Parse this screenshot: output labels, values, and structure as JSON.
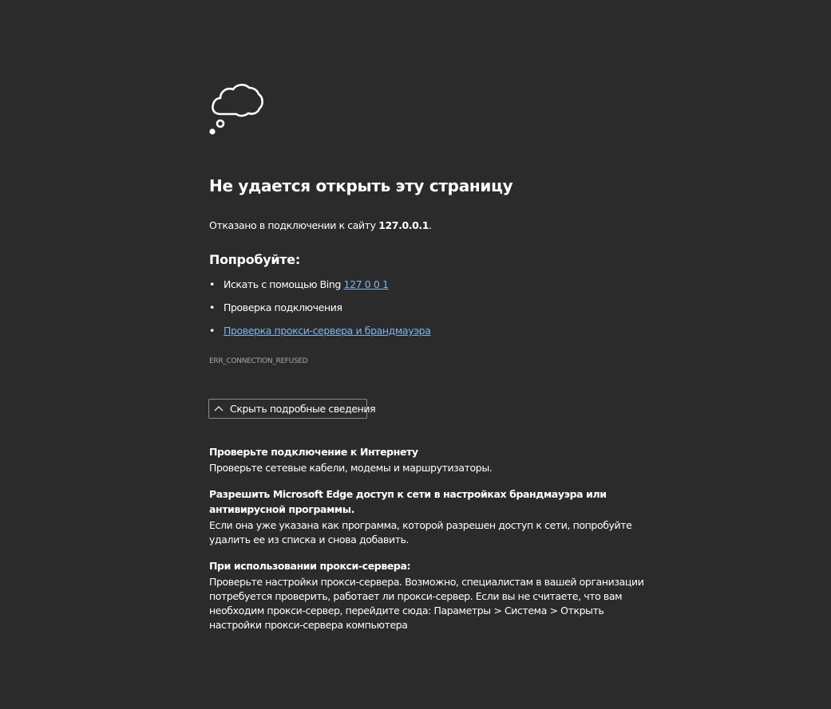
{
  "colors": {
    "background": "#2b2b2b",
    "text": "#ffffff",
    "link": "#7db5ea",
    "muted": "#a6a6a6",
    "button_border": "#8a8a8a"
  },
  "icon": "cloud-thought-icon",
  "title": "Не удается открыть эту страницу",
  "refused": {
    "prefix": "Отказано в подключении к сайту ",
    "host": "127.0.0.1",
    "suffix": "."
  },
  "try": {
    "heading": "Попробуйте:",
    "items": [
      {
        "text": "Искать с помощью Bing ",
        "link": "127 0 0 1"
      },
      {
        "text": "Проверка подключения",
        "link": ""
      },
      {
        "text": "",
        "link": "Проверка прокси-сервера и брандмауэра"
      }
    ]
  },
  "error_code": "ERR_CONNECTION_REFUSED",
  "details_button": {
    "label": "Скрыть подробные сведения",
    "icon": "chevron-up-icon"
  },
  "details": [
    {
      "heading": "Проверьте подключение к Интернету",
      "body": "Проверьте сетевые кабели, модемы и маршрутизаторы."
    },
    {
      "heading": "Разрешить Microsoft Edge доступ к сети в настройках брандмауэра или антивирусной программы.",
      "body": "Если она уже указана как программа, которой разрешен доступ к сети, попробуйте удалить ее из списка и снова добавить."
    },
    {
      "heading": "При использовании прокси-сервера:",
      "body": "Проверьте настройки прокси-сервера. Возможно, специалистам в вашей организации потребуется проверить, работает ли прокси-сервер. Если вы не считаете, что вам необходим прокси-сервер, перейдите сюда: Параметры > Система > Открыть настройки прокси-сервера компьютера"
    }
  ]
}
